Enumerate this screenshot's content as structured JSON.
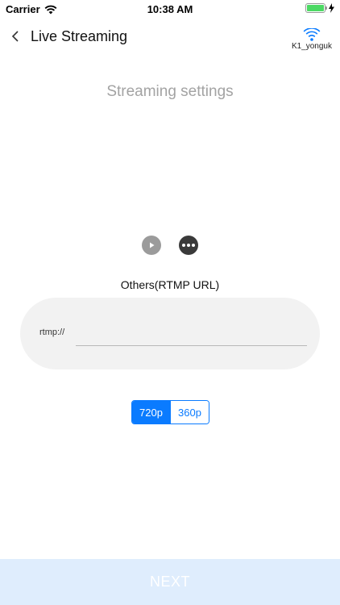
{
  "status_bar": {
    "carrier": "Carrier",
    "time": "10:38 AM",
    "signal_icon": "wifi-signal-icon",
    "battery_icon": "battery-icon",
    "charging_icon": "charging-bolt-icon",
    "battery_color": "#4cd964"
  },
  "nav": {
    "back_icon": "chevron-left-icon",
    "title": "Live Streaming",
    "wifi_icon": "wifi-icon",
    "wifi_label": "K1_yonguk",
    "wifi_color": "#0a7bff"
  },
  "main": {
    "title": "Streaming settings",
    "icons": [
      "play-icon",
      "more-icon"
    ],
    "section_label": "Others(RTMP  URL)",
    "url_prefix": "rtmp://",
    "url_value": "",
    "url_placeholder": ""
  },
  "resolution": {
    "options": [
      "720p",
      "360p"
    ],
    "selected": "720p",
    "accent": "#0a7bff"
  },
  "footer": {
    "next_label": "NEXT",
    "next_bg": "#dfedfd"
  }
}
